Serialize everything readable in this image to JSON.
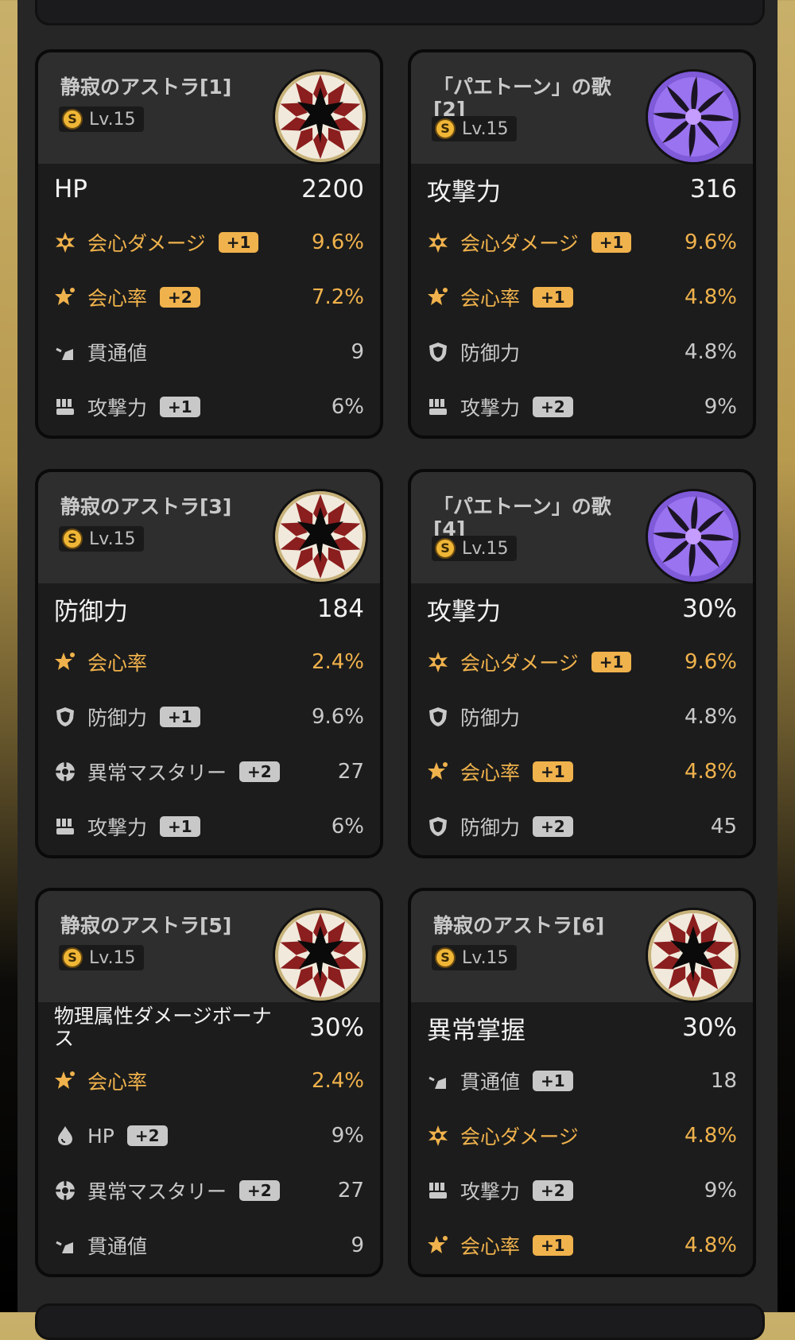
{
  "level_icon_letter": "S",
  "colors": {
    "highlight": "#f0b24c",
    "normal": "#c9c9c9",
    "panel": "#262626",
    "card": "#1c1c1c"
  },
  "cards": [
    {
      "title": "静寂のアストラ[1]",
      "level": "Lv.15",
      "disc": "astra",
      "main": {
        "name": "HP",
        "value": "2200"
      },
      "subs": [
        {
          "icon": "crit-damage-icon",
          "name": "会心ダメージ",
          "bump": "+1",
          "value": "9.6%",
          "highlight": true
        },
        {
          "icon": "crit-rate-icon",
          "name": "会心率",
          "bump": "+2",
          "value": "7.2%",
          "highlight": true
        },
        {
          "icon": "pen-icon",
          "name": "貫通値",
          "bump": "",
          "value": "9",
          "highlight": false
        },
        {
          "icon": "atk-icon",
          "name": "攻撃力",
          "bump": "+1",
          "value": "6%",
          "highlight": false
        }
      ]
    },
    {
      "title": "「パエトーン」の歌[2]",
      "level": "Lv.15",
      "disc": "phaethon",
      "main": {
        "name": "攻撃力",
        "value": "316"
      },
      "subs": [
        {
          "icon": "crit-damage-icon",
          "name": "会心ダメージ",
          "bump": "+1",
          "value": "9.6%",
          "highlight": true
        },
        {
          "icon": "crit-rate-icon",
          "name": "会心率",
          "bump": "+1",
          "value": "4.8%",
          "highlight": true
        },
        {
          "icon": "def-icon",
          "name": "防御力",
          "bump": "",
          "value": "4.8%",
          "highlight": false
        },
        {
          "icon": "atk-icon",
          "name": "攻撃力",
          "bump": "+2",
          "value": "9%",
          "highlight": false
        }
      ]
    },
    {
      "title": "静寂のアストラ[3]",
      "level": "Lv.15",
      "disc": "astra",
      "main": {
        "name": "防御力",
        "value": "184"
      },
      "subs": [
        {
          "icon": "crit-rate-icon",
          "name": "会心率",
          "bump": "",
          "value": "2.4%",
          "highlight": true
        },
        {
          "icon": "def-icon",
          "name": "防御力",
          "bump": "+1",
          "value": "9.6%",
          "highlight": false
        },
        {
          "icon": "mastery-icon",
          "name": "異常マスタリー",
          "bump": "+2",
          "value": "27",
          "highlight": false
        },
        {
          "icon": "atk-icon",
          "name": "攻撃力",
          "bump": "+1",
          "value": "6%",
          "highlight": false
        }
      ]
    },
    {
      "title": "「パエトーン」の歌[4]",
      "level": "Lv.15",
      "disc": "phaethon",
      "main": {
        "name": "攻撃力",
        "value": "30%"
      },
      "subs": [
        {
          "icon": "crit-damage-icon",
          "name": "会心ダメージ",
          "bump": "+1",
          "value": "9.6%",
          "highlight": true
        },
        {
          "icon": "def-icon",
          "name": "防御力",
          "bump": "",
          "value": "4.8%",
          "highlight": false
        },
        {
          "icon": "crit-rate-icon",
          "name": "会心率",
          "bump": "+1",
          "value": "4.8%",
          "highlight": true
        },
        {
          "icon": "def-icon",
          "name": "防御力",
          "bump": "+2",
          "value": "45",
          "highlight": false
        }
      ]
    },
    {
      "title": "静寂のアストラ[5]",
      "level": "Lv.15",
      "disc": "astra",
      "main": {
        "name": "物理属性ダメージボーナス",
        "value": "30%"
      },
      "subs": [
        {
          "icon": "crit-rate-icon",
          "name": "会心率",
          "bump": "",
          "value": "2.4%",
          "highlight": true
        },
        {
          "icon": "hp-icon",
          "name": "HP",
          "bump": "+2",
          "value": "9%",
          "highlight": false
        },
        {
          "icon": "mastery-icon",
          "name": "異常マスタリー",
          "bump": "+2",
          "value": "27",
          "highlight": false
        },
        {
          "icon": "pen-icon",
          "name": "貫通値",
          "bump": "",
          "value": "9",
          "highlight": false
        }
      ]
    },
    {
      "title": "静寂のアストラ[6]",
      "level": "Lv.15",
      "disc": "astra",
      "main": {
        "name": "異常掌握",
        "value": "30%"
      },
      "subs": [
        {
          "icon": "pen-icon",
          "name": "貫通値",
          "bump": "+1",
          "value": "18",
          "highlight": false
        },
        {
          "icon": "crit-damage-icon",
          "name": "会心ダメージ",
          "bump": "",
          "value": "4.8%",
          "highlight": true
        },
        {
          "icon": "atk-icon",
          "name": "攻撃力",
          "bump": "+2",
          "value": "9%",
          "highlight": false
        },
        {
          "icon": "crit-rate-icon",
          "name": "会心率",
          "bump": "+1",
          "value": "4.8%",
          "highlight": true
        }
      ]
    }
  ]
}
